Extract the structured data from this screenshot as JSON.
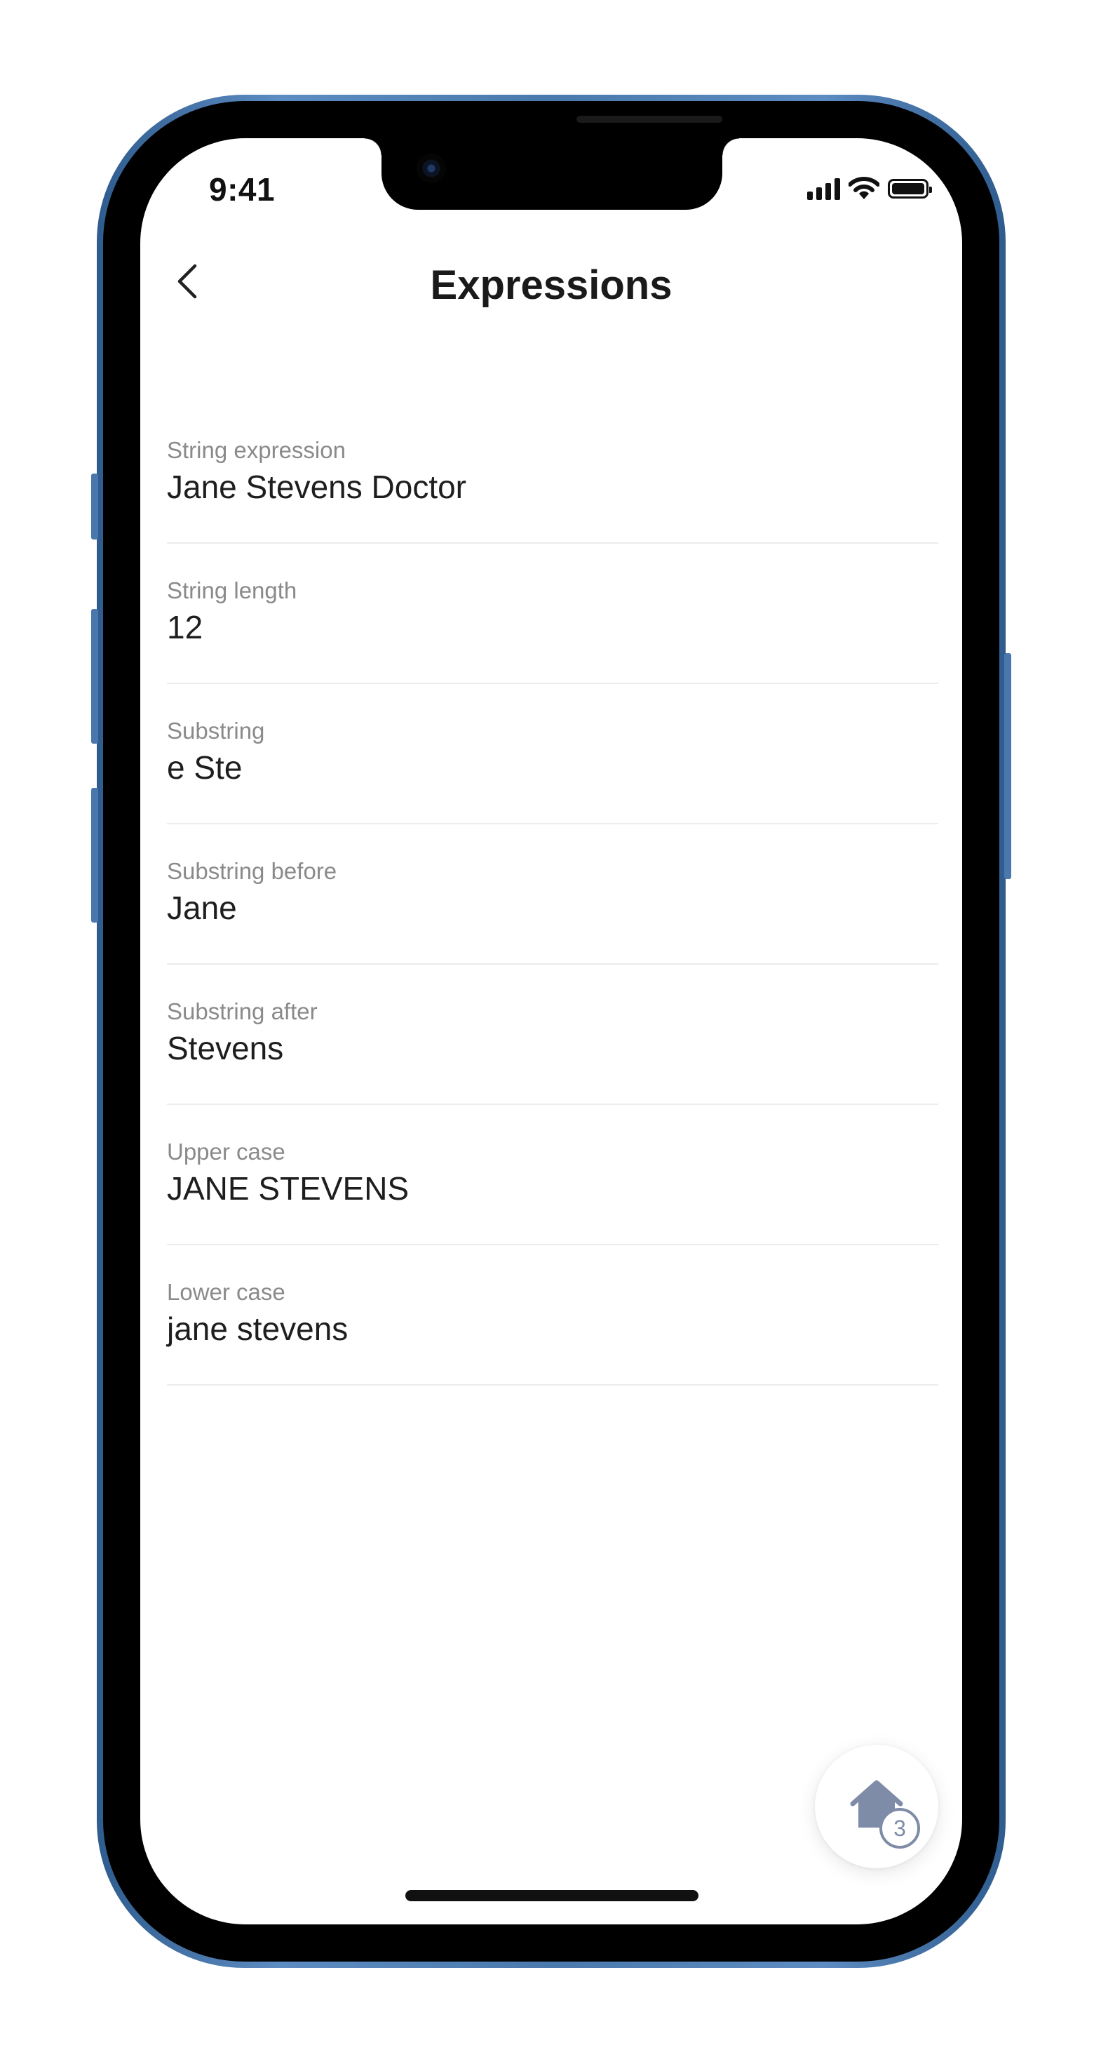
{
  "status_bar": {
    "time": "9:41"
  },
  "nav": {
    "title": "Expressions"
  },
  "rows": [
    {
      "label": "String expression",
      "value": "Jane Stevens Doctor"
    },
    {
      "label": "String length",
      "value": "12"
    },
    {
      "label": "Substring",
      "value": "e Ste"
    },
    {
      "label": "Substring before",
      "value": "Jane"
    },
    {
      "label": "Substring after",
      "value": "Stevens"
    },
    {
      "label": "Upper case",
      "value": "JANE STEVENS"
    },
    {
      "label": "Lower case",
      "value": "jane stevens"
    }
  ],
  "fab": {
    "badge": "3",
    "icon": "home-icon"
  },
  "colors": {
    "frame": "#4a79ad",
    "fab_icon": "#7f8ca8",
    "label": "#8a8a8a",
    "value": "#1e1e1e"
  }
}
